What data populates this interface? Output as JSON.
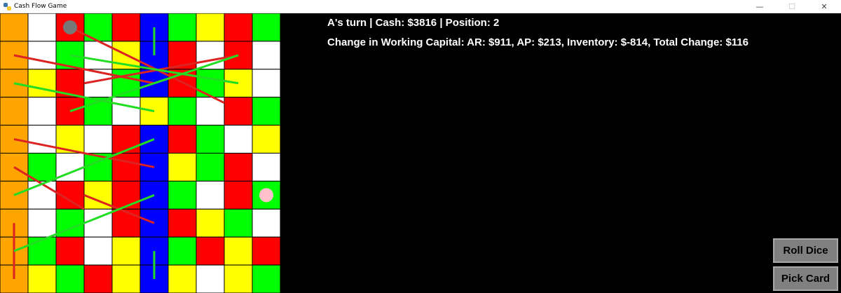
{
  "window": {
    "title": "Cash Flow Game",
    "controls": {
      "minimize": "—",
      "maximize": "☐",
      "close": "✕"
    }
  },
  "status": {
    "line": "A's turn | Cash: $3816 | Position: 2",
    "working_capital": "Change in Working Capital: AR: $911, AP: $213, Inventory: $-814, Total Change: $116"
  },
  "buttons": {
    "roll_dice": "Roll Dice",
    "pick_card": "Pick Card"
  },
  "board": {
    "rows": 10,
    "cols": 10,
    "colors": {
      "O": "#ffa500",
      "W": "#ffffff",
      "R": "#ff0000",
      "G": "#00ff00",
      "Y": "#ffff00",
      "B": "#0000ff"
    },
    "grid": [
      "OWRGRBGYRG",
      "OWGWYBRWRW",
      "OYRWGBRGYW",
      "OWRGWYGWRG",
      "OWYWRBRGWY",
      "OGWGRBYGRW",
      "OWRYRBGWRG",
      "OWGWRBRYGW",
      "OGRWYBGRYR",
      "OYGRYBYWYG"
    ],
    "tokens": [
      {
        "name": "token-a",
        "row": 0,
        "col": 2,
        "color": "#777777"
      },
      {
        "name": "token-b",
        "row": 6,
        "col": 9,
        "color": "#ffc0cb"
      }
    ],
    "ladders": [
      {
        "from": [
          0.5,
          5.5
        ],
        "to": [
          1.5,
          5.5
        ]
      },
      {
        "from": [
          2.5,
          0.5
        ],
        "to": [
          3.5,
          5.5
        ]
      },
      {
        "from": [
          1.5,
          2.5
        ],
        "to": [
          2.5,
          8.5
        ]
      },
      {
        "from": [
          3.5,
          2.5
        ],
        "to": [
          1.5,
          8.5
        ]
      },
      {
        "from": [
          6.5,
          0.5
        ],
        "to": [
          4.5,
          5.5
        ]
      },
      {
        "from": [
          8.5,
          0.5
        ],
        "to": [
          6.5,
          5.5
        ]
      },
      {
        "from": [
          8.5,
          5.5
        ],
        "to": [
          9.5,
          5.5
        ]
      }
    ],
    "snakes": [
      {
        "from": [
          0.5,
          2.5
        ],
        "to": [
          3.2,
          8
        ]
      },
      {
        "from": [
          1.5,
          0.5
        ],
        "to": [
          2.5,
          5.5
        ]
      },
      {
        "from": [
          2.5,
          3
        ],
        "to": [
          1.5,
          8.5
        ]
      },
      {
        "from": [
          4.5,
          0.5
        ],
        "to": [
          5.5,
          5.5
        ]
      },
      {
        "from": [
          5.5,
          0.5
        ],
        "to": [
          7,
          3
        ]
      },
      {
        "from": [
          6.5,
          3
        ],
        "to": [
          7.5,
          5.5
        ]
      },
      {
        "from": [
          7.5,
          0.5
        ],
        "to": [
          9.5,
          0.5
        ]
      }
    ],
    "snake_color": "#dd2222",
    "ladder_color": "#22dd22"
  }
}
